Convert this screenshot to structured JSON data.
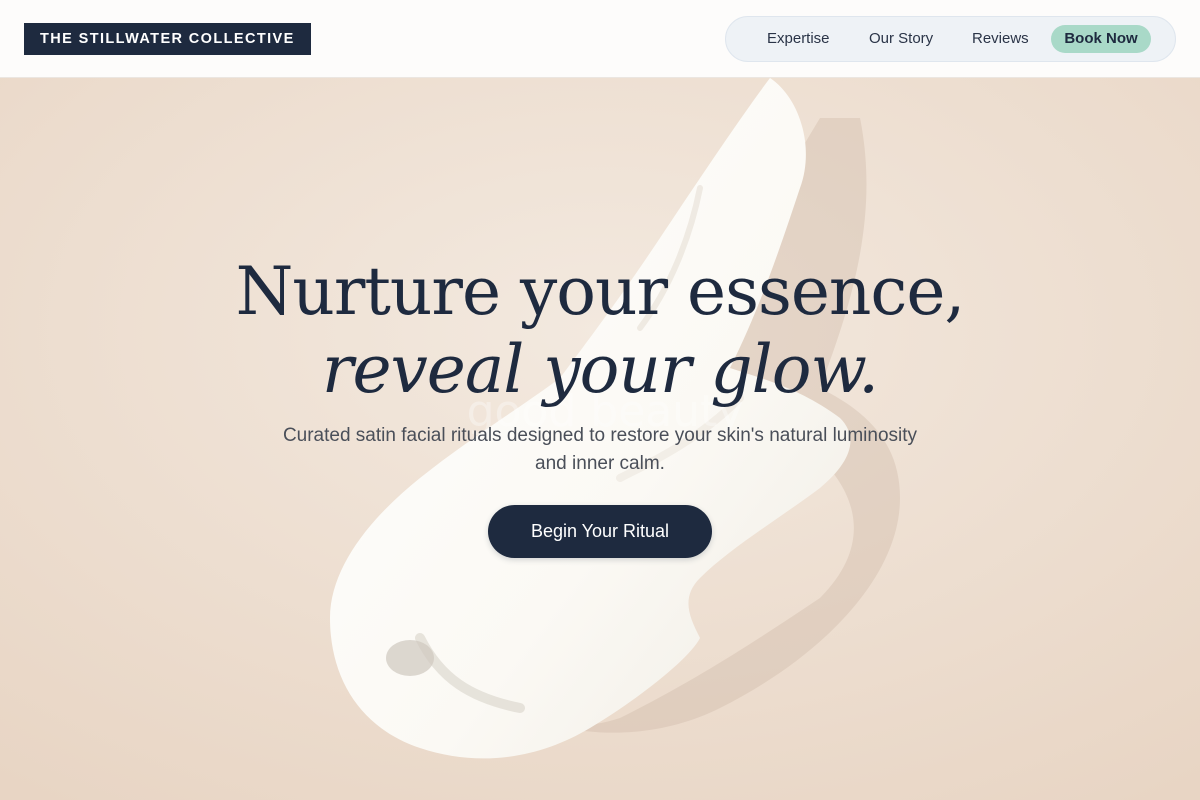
{
  "header": {
    "brand": "THE STILLWATER COLLECTIVE",
    "nav": {
      "expertise": "Expertise",
      "story": "Our Story",
      "reviews": "Reviews",
      "cta": "Book Now"
    }
  },
  "hero": {
    "title_line1": "Nurture your essence,",
    "title_line2": "reveal your glow.",
    "subtitle": "Curated satin facial rituals designed to restore your skin's natural luminosity and inner calm.",
    "cta": "Begin Your Ritual",
    "image_watermark": "good beauty"
  },
  "colors": {
    "navy": "#1e2a3f",
    "mint": "#a9d9c8",
    "sand": "#efe4da",
    "cream": "#fbf9f4"
  }
}
